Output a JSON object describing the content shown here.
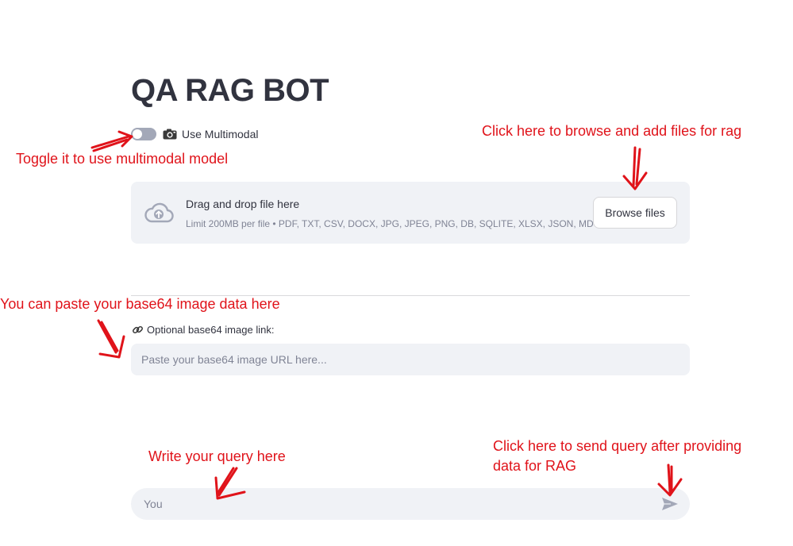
{
  "app": {
    "title": "QA RAG BOT"
  },
  "multimodal_toggle": {
    "label": "Use Multimodal",
    "icon": "camera-icon",
    "checked": false
  },
  "uploader": {
    "icon": "cloud-upload-icon",
    "title": "Drag and drop file here",
    "limit": "Limit 200MB per file • PDF, TXT, CSV, DOCX, JPG, JPEG, PNG, DB, SQLITE, XLSX, JSON, MD",
    "button_label": "Browse files"
  },
  "base64": {
    "icon": "link-icon",
    "label": "Optional base64 image link:",
    "placeholder": "Paste your base64 image URL here...",
    "value": ""
  },
  "chat": {
    "placeholder": "You",
    "value": "",
    "send_icon": "send-icon"
  },
  "annotations": {
    "toggle_hint": "Toggle it to use multimodal model",
    "browse_hint": "Click here to browse and add files for rag",
    "base64_hint": "You can paste your base64 image data here",
    "query_hint": "Write your query here",
    "send_hint_line1": "Click here to send query after providing",
    "send_hint_line2": "data for RAG"
  },
  "colors": {
    "annotation": "#e0131a",
    "panel_bg": "#f0f2f6",
    "text": "#31333f",
    "muted_text": "#808495"
  }
}
